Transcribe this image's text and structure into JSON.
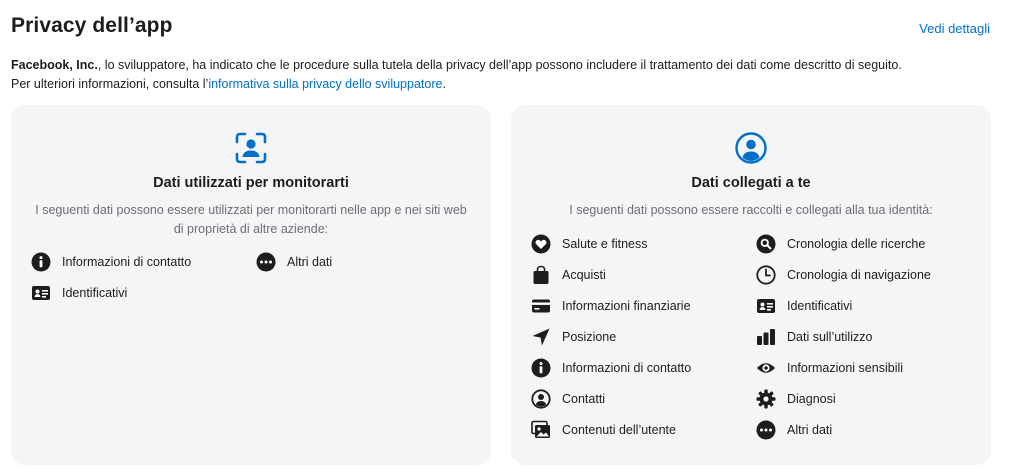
{
  "header": {
    "title": "Privacy dell’app",
    "details_link": "Vedi dettagli"
  },
  "description": {
    "developer": "Facebook, Inc.",
    "text_1": ", lo sviluppatore, ha indicato che le procedure sulla tutela della privacy dell’app possono includere il trattamento dei dati come descritto di seguito.",
    "text_2": "Per ulteriori informazioni, consulta l’",
    "policy_link": "informativa sulla privacy dello sviluppatore",
    "text_3": "."
  },
  "tracking_card": {
    "title": "Dati utilizzati per monitorarti",
    "subtitle": "I seguenti dati possono essere utilizzati per monitorarti nelle app e nei siti web di proprietà di altre aziende:",
    "items": [
      {
        "label": "Informazioni di contatto",
        "icon": "info-icon"
      },
      {
        "label": "Altri dati",
        "icon": "more-icon"
      },
      {
        "label": "Identificativi",
        "icon": "id-card-icon"
      }
    ]
  },
  "linked_card": {
    "title": "Dati collegati a te",
    "subtitle": "I seguenti dati possono essere raccolti e collegati alla tua identità:",
    "items": [
      {
        "label": "Salute e fitness",
        "icon": "heart-icon"
      },
      {
        "label": "Cronologia delle ricerche",
        "icon": "search-icon"
      },
      {
        "label": "Acquisti",
        "icon": "bag-icon"
      },
      {
        "label": "Cronologia di navigazione",
        "icon": "clock-icon"
      },
      {
        "label": "Informazioni finanziarie",
        "icon": "credit-card-icon"
      },
      {
        "label": "Identificativi",
        "icon": "id-card-icon"
      },
      {
        "label": "Posizione",
        "icon": "location-icon"
      },
      {
        "label": "Dati sull’utilizzo",
        "icon": "bar-chart-icon"
      },
      {
        "label": "Informazioni di contatto",
        "icon": "info-icon"
      },
      {
        "label": "Informazioni sensibili",
        "icon": "eye-icon"
      },
      {
        "label": "Contatti",
        "icon": "contact-icon"
      },
      {
        "label": "Diagnosi",
        "icon": "gear-icon"
      },
      {
        "label": "Contenuti dell’utente",
        "icon": "photos-icon"
      },
      {
        "label": "Altri dati",
        "icon": "more-icon"
      }
    ]
  },
  "colors": {
    "accent": "#0070c9",
    "card_bg": "#f5f5f7",
    "text": "#1d1d1f",
    "secondary_text": "#6e6e73"
  }
}
